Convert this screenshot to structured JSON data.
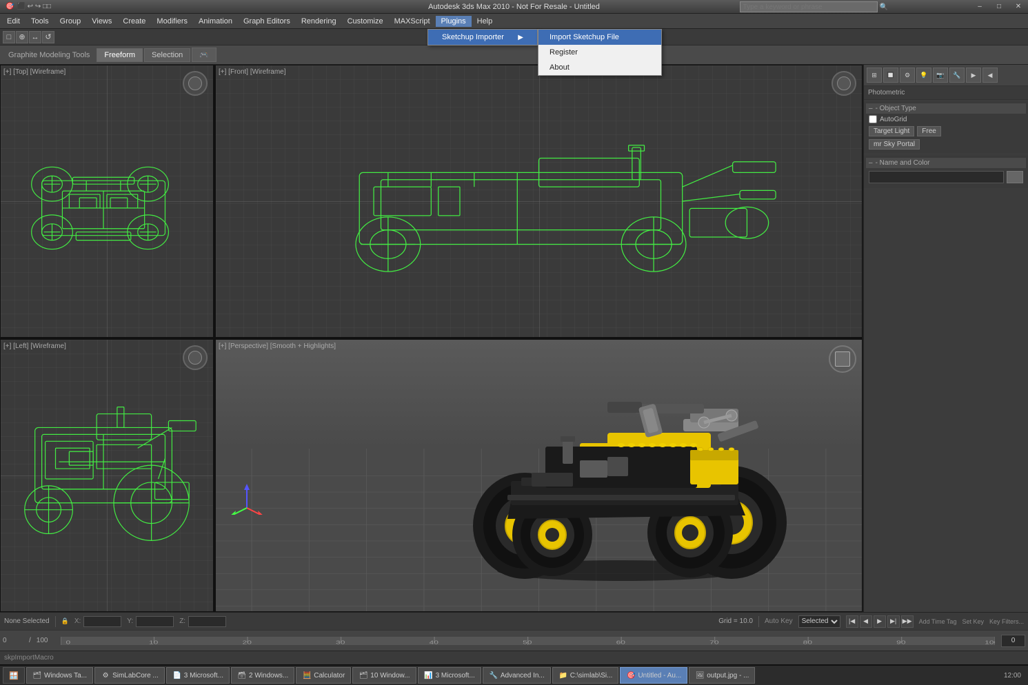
{
  "titlebar": {
    "title": "Autodesk 3ds Max 2010 - Not For Resale - Untitled",
    "search_placeholder": "Type a keyword or phrase"
  },
  "menubar": {
    "items": [
      {
        "label": "Edit",
        "id": "edit"
      },
      {
        "label": "Tools",
        "id": "tools"
      },
      {
        "label": "Group",
        "id": "group"
      },
      {
        "label": "Views",
        "id": "views"
      },
      {
        "label": "Create",
        "id": "create"
      },
      {
        "label": "Modifiers",
        "id": "modifiers"
      },
      {
        "label": "Animation",
        "id": "animation"
      },
      {
        "label": "Graph Editors",
        "id": "graph-editors"
      },
      {
        "label": "Rendering",
        "id": "rendering"
      },
      {
        "label": "Customize",
        "id": "customize"
      },
      {
        "label": "MAXScript",
        "id": "maxscript"
      },
      {
        "label": "Plugins",
        "id": "plugins",
        "active": true
      },
      {
        "label": "Help",
        "id": "help"
      }
    ]
  },
  "plugins_menu": {
    "items": [
      {
        "label": "Sketchup Importer",
        "id": "sketchup-importer",
        "has_submenu": true
      }
    ]
  },
  "sketchup_submenu": {
    "items": [
      {
        "label": "Import Sketchup File",
        "id": "import-sketchup",
        "highlighted": true
      },
      {
        "label": "Register",
        "id": "register"
      },
      {
        "label": "About",
        "id": "about"
      }
    ]
  },
  "modeling_bar": {
    "label": "Graphite Modeling Tools",
    "tabs": [
      {
        "label": "Freeform",
        "id": "freeform"
      },
      {
        "label": "Selection",
        "id": "selection"
      },
      {
        "label": "⬛",
        "id": "extra"
      }
    ]
  },
  "viewports": {
    "top": {
      "label": "[+] [Top] [Wireframe]"
    },
    "front": {
      "label": "[+] [Front] [Wireframe]"
    },
    "left": {
      "label": "[+] [Left] [Wireframe]"
    },
    "perspective": {
      "label": "[+] [Perspective] [Smooth + Highlights]"
    }
  },
  "right_panel": {
    "section_object_type": "- Object Type",
    "autogrid_label": "AutoGrid",
    "btn_target_light": "Target Light",
    "btn_free": "Free",
    "btn_mr_sky_portal": "mr Sky Portal",
    "section_name_color": "- Name and Color",
    "photometric_label": "Photometric"
  },
  "status_bar": {
    "none_selected": "None Selected",
    "macro_label": "skpImportMacro",
    "x_label": "X:",
    "y_label": "Y:",
    "z_label": "Z:",
    "grid_label": "Grid = 10.0",
    "auto_key_label": "Auto Key",
    "selected_label": "Selected",
    "add_time_tag": "Add Time Tag",
    "set_key": "Set Key",
    "key_filters": "Key Filters..."
  },
  "timeline": {
    "start": "0",
    "end": "100",
    "current": "0"
  },
  "taskbar": {
    "items": [
      {
        "label": "Windows Ta...",
        "id": "windows-ta",
        "active": false
      },
      {
        "label": "SimLabCore ...",
        "id": "simlab",
        "active": false
      },
      {
        "label": "3 Microsoft...",
        "id": "microsoft3",
        "active": false
      },
      {
        "label": "2 Windows...",
        "id": "windows2",
        "active": false
      },
      {
        "label": "Calculator",
        "id": "calculator",
        "active": false
      },
      {
        "label": "10 Window...",
        "id": "windows10",
        "active": false
      },
      {
        "label": "3 Microsoft...",
        "id": "microsoft3b",
        "active": false
      },
      {
        "label": "Advanced In...",
        "id": "advanced",
        "active": false
      },
      {
        "label": "C:\\simlab\\Si...",
        "id": "simlab-path",
        "active": false
      },
      {
        "label": "Untitled - Au...",
        "id": "untitled-au",
        "active": true
      },
      {
        "label": "output.jpg - ...",
        "id": "output-jpg",
        "active": false
      }
    ]
  },
  "colors": {
    "accent_blue": "#3e6db4",
    "menu_bg": "#f0f0f0",
    "wireframe_green": "#44ff44",
    "viewport_bg": "#3a3a3a",
    "panel_bg": "#3c3c3c"
  }
}
